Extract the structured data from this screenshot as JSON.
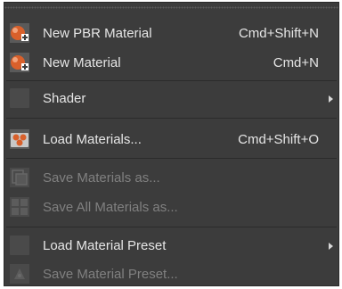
{
  "menu": {
    "items": [
      {
        "label": "New PBR Material",
        "shortcut": "Cmd+Shift+N",
        "icon": "new-pbr-material-icon",
        "enabled": true
      },
      {
        "label": "New Material",
        "shortcut": "Cmd+N",
        "icon": "new-material-icon",
        "enabled": true
      },
      {
        "label": "Shader",
        "submenu": true,
        "enabled": true
      },
      {
        "label": "Load Materials...",
        "shortcut": "Cmd+Shift+O",
        "icon": "load-materials-icon",
        "enabled": true
      },
      {
        "label": "Save Materials as...",
        "icon": "save-materials-icon",
        "enabled": false
      },
      {
        "label": "Save All Materials as...",
        "icon": "save-all-materials-icon",
        "enabled": false
      },
      {
        "label": "Load Material Preset",
        "submenu": true,
        "enabled": true
      },
      {
        "label": "Save Material Preset...",
        "icon": "save-material-preset-icon",
        "enabled": false
      }
    ]
  },
  "colors": {
    "background": "#3c3c3c",
    "text": "#e6e6e6",
    "text_disabled": "#808080",
    "separator": "#2b2b2b",
    "icon_orange": "#d9602b"
  }
}
